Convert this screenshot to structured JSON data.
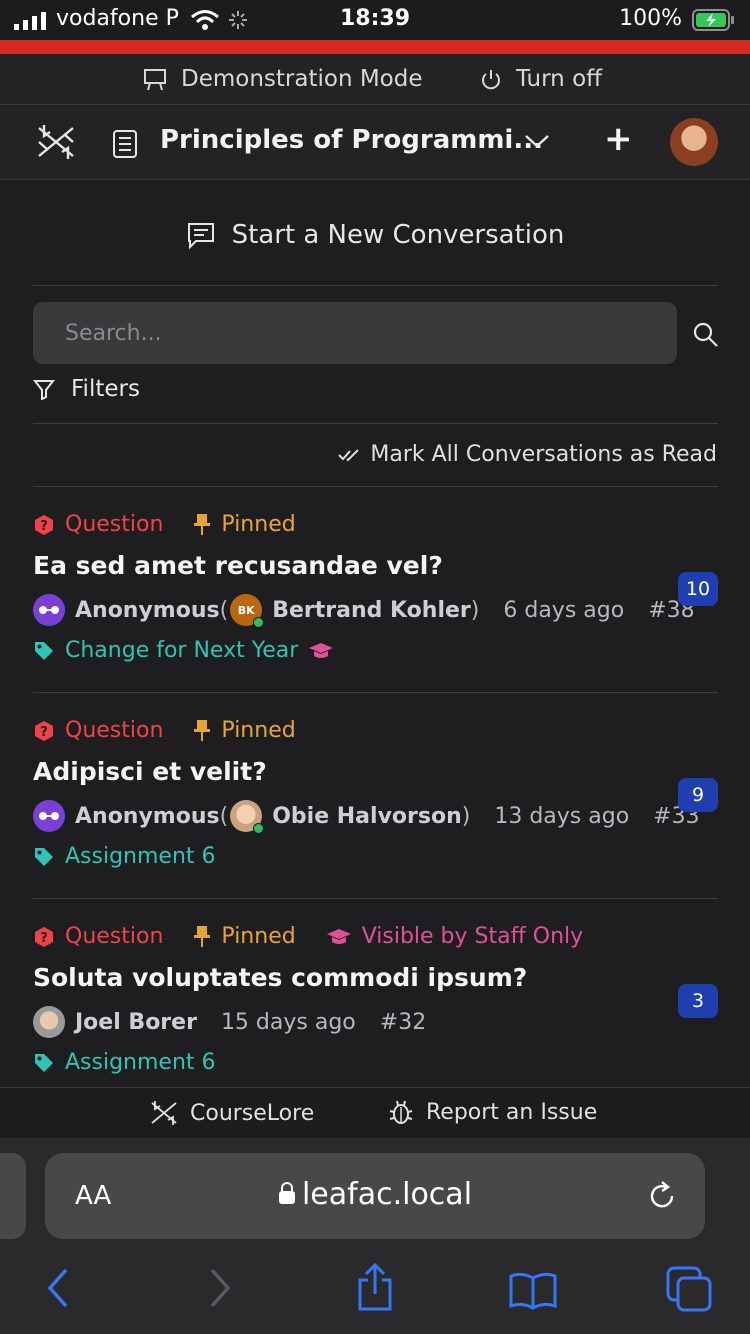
{
  "status_bar": {
    "carrier": "vodafone P",
    "time": "18:39",
    "battery": "100%"
  },
  "demo_bar": {
    "mode_label": "Demonstration Mode",
    "turn_off_label": "Turn off"
  },
  "header": {
    "course_title": "Principles of Programmi...",
    "add_label": "+"
  },
  "main": {
    "new_conversation_label": "Start a New Conversation",
    "search_placeholder": "Search...",
    "filters_label": "Filters",
    "mark_read_label": "Mark All Conversations as Read"
  },
  "conversations": [
    {
      "type": "Question",
      "pinned": "Pinned",
      "title": "Ea sed amet recusandae vel?",
      "author": "Anonymous",
      "author_open": " (",
      "author_initials": "BK",
      "real_name": "Bertrand Kohler",
      "author_close": ")",
      "time": "6 days ago",
      "number": "#38",
      "tag": "Change for Next Year",
      "unread": "10"
    },
    {
      "type": "Question",
      "pinned": "Pinned",
      "title": "Adipisci et velit?",
      "author": "Anonymous",
      "author_open": " (",
      "real_name": "Obie Halvorson",
      "author_close": ")",
      "time": "13 days ago",
      "number": "#33",
      "tag": "Assignment 6",
      "unread": "9"
    },
    {
      "type": "Question",
      "pinned": "Pinned",
      "visibility": "Visible by Staff Only",
      "title": "Soluta voluptates commodi ipsum?",
      "author": "Joel Borer",
      "time": "15 days ago",
      "number": "#32",
      "tag": "Assignment 6",
      "unread": "3"
    }
  ],
  "footer": {
    "brand_label": "CourseLore",
    "report_label": "Report an Issue"
  },
  "browser": {
    "text_size_label": "AA",
    "url": "leafac.local"
  },
  "colors": {
    "question": "#f1424a",
    "pinned": "#e9a530",
    "staff": "#e34f9a",
    "tag": "#2ec4b6",
    "badge": "#1f3fb0",
    "alert_bar": "#d62b22"
  }
}
